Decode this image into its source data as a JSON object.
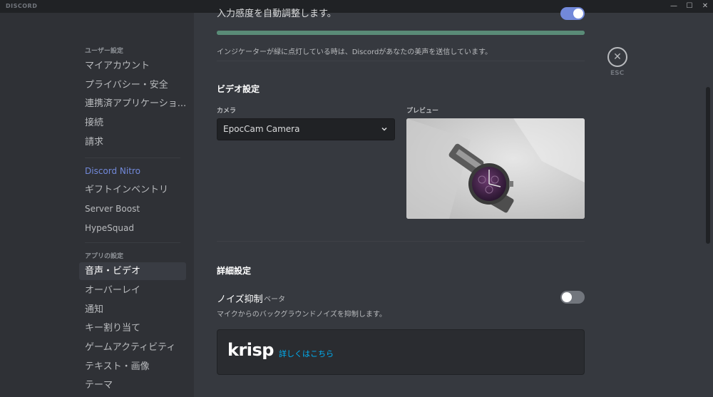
{
  "window": {
    "brand": "DISCORD",
    "minimize": "—",
    "maximize": "☐",
    "close": "✕"
  },
  "sidebar": {
    "user_settings_header": "ユーザー設定",
    "user_items": [
      "マイアカウント",
      "プライバシー・安全",
      "連携済アプリケーショ...",
      "接続",
      "請求"
    ],
    "nitro_items": [
      "Discord Nitro",
      "ギフトインベントリ",
      "Server Boost",
      "HypeSquad"
    ],
    "app_settings_header": "アプリの設定",
    "app_items": [
      "音声・ビデオ",
      "オーバーレイ",
      "通知",
      "キー割り当て",
      "ゲームアクティビティ",
      "テキスト・画像",
      "テーマ"
    ],
    "active_item": "音声・ビデオ"
  },
  "voice": {
    "auto_sensitivity_label": "入力感度を自動調整します。",
    "auto_sensitivity_on": true,
    "meter_level": 1.0,
    "indicator_hint": "インジケーターが緑に点灯している時は、Discordがあなたの美声を送信しています。"
  },
  "video": {
    "title": "ビデオ設定",
    "camera_label": "カメラ",
    "camera_value": "EpocCam Camera",
    "preview_label": "プレビュー"
  },
  "close_button": {
    "icon": "close-icon",
    "label": "ESC"
  },
  "advanced": {
    "title": "詳細設定",
    "noise_label": "ノイズ抑制",
    "beta_label": "ベータ",
    "noise_hint": "マイクからのバックグラウンドノイズを抑制します。",
    "noise_on": false,
    "krisp_logo": "krisp",
    "krisp_link": "詳しくはこちら"
  },
  "colors": {
    "accent": "#7289da",
    "green": "#43b581",
    "link": "#00b0f4"
  }
}
